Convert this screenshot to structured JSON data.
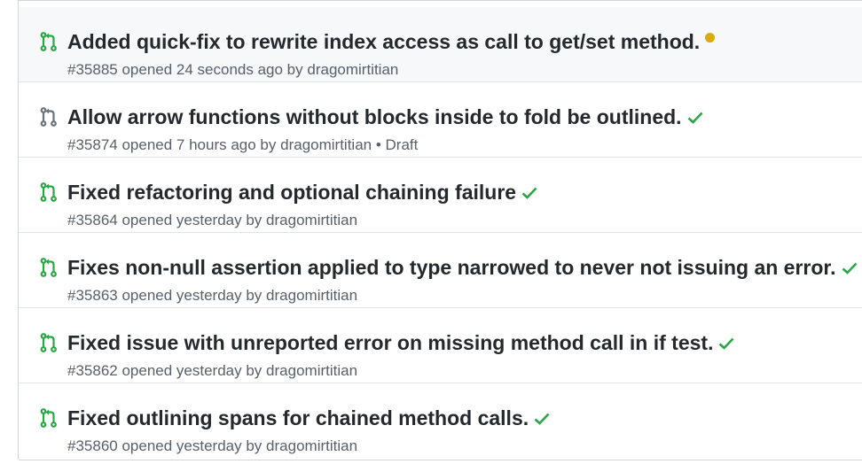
{
  "colors": {
    "open_pr_icon": "#28a745",
    "draft_pr_icon": "#6a737d",
    "check_success": "#28a745",
    "status_pending": "#dbab09",
    "title_text": "#24292e",
    "meta_text": "#586069"
  },
  "pull_requests": [
    {
      "title": "Added quick-fix to rewrite index access as call to get/set method.",
      "number": "#35885",
      "opened_text": "opened 24 seconds ago by",
      "author": "dragomirtitian",
      "draft_label": "",
      "icon": "git-pull-request-icon",
      "status": "pending-dot",
      "highlighted": true
    },
    {
      "title": "Allow arrow functions without blocks inside to fold be outlined.",
      "number": "#35874",
      "opened_text": "opened 7 hours ago by",
      "author": "dragomirtitian",
      "draft_label": "• Draft",
      "icon": "git-pull-request-draft-icon",
      "status": "check",
      "highlighted": false
    },
    {
      "title": "Fixed refactoring and optional chaining failure",
      "number": "#35864",
      "opened_text": "opened yesterday by",
      "author": "dragomirtitian",
      "draft_label": "",
      "icon": "git-pull-request-icon",
      "status": "check",
      "highlighted": false
    },
    {
      "title": "Fixes non-null assertion applied to type narrowed to never not issuing an error.",
      "number": "#35863",
      "opened_text": "opened yesterday by",
      "author": "dragomirtitian",
      "draft_label": "",
      "icon": "git-pull-request-icon",
      "status": "check",
      "highlighted": false
    },
    {
      "title": "Fixed issue with unreported error on missing method call in if test.",
      "number": "#35862",
      "opened_text": "opened yesterday by",
      "author": "dragomirtitian",
      "draft_label": "",
      "icon": "git-pull-request-icon",
      "status": "check",
      "highlighted": false
    },
    {
      "title": "Fixed outlining spans for chained method calls.",
      "number": "#35860",
      "opened_text": "opened yesterday by",
      "author": "dragomirtitian",
      "draft_label": "",
      "icon": "git-pull-request-icon",
      "status": "check",
      "highlighted": false
    }
  ]
}
